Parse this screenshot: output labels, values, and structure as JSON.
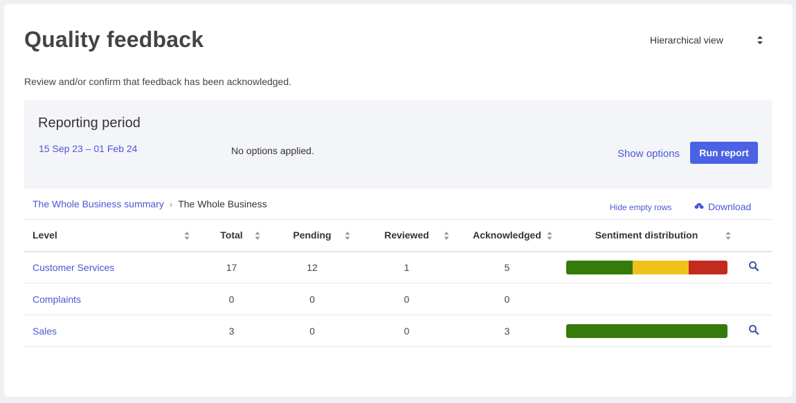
{
  "page": {
    "title": "Quality feedback",
    "subtitle": "Review and/or confirm that feedback has been acknowledged."
  },
  "view_select": {
    "value": "Hierarchical view"
  },
  "reporting": {
    "title": "Reporting period",
    "range": "15 Sep 23 – 01 Feb 24",
    "options_status": "No options applied.",
    "show_options_label": "Show options",
    "run_report_label": "Run report"
  },
  "breadcrumb": {
    "link": "The Whole Business summary",
    "separator": "›",
    "current": "The Whole Business"
  },
  "actions": {
    "hide_empty_label": "Hide empty rows",
    "download_label": "Download"
  },
  "table": {
    "columns": [
      "Level",
      "Total",
      "Pending",
      "Reviewed",
      "Acknowledged",
      "Sentiment distribution"
    ],
    "rows": [
      {
        "level": "Customer Services",
        "total": "17",
        "pending": "12",
        "reviewed": "1",
        "acknowledged": "5",
        "sentiment": {
          "positive": 0.41,
          "neutral": 0.35,
          "negative": 0.24
        }
      },
      {
        "level": "Complaints",
        "total": "0",
        "pending": "0",
        "reviewed": "0",
        "acknowledged": "0",
        "sentiment": null
      },
      {
        "level": "Sales",
        "total": "3",
        "pending": "0",
        "reviewed": "0",
        "acknowledged": "3",
        "sentiment": {
          "positive": 1.0,
          "neutral": 0.0,
          "negative": 0.0
        }
      }
    ]
  },
  "colors": {
    "accent": "#4a57d6",
    "button": "#4a62e3",
    "positive": "#357a0b",
    "neutral": "#efc21b",
    "negative": "#c22b1d"
  },
  "icons": {
    "sort": "sort-icon",
    "search": "search-icon",
    "download": "cloud-download-icon",
    "select": "select-caret-icon"
  }
}
